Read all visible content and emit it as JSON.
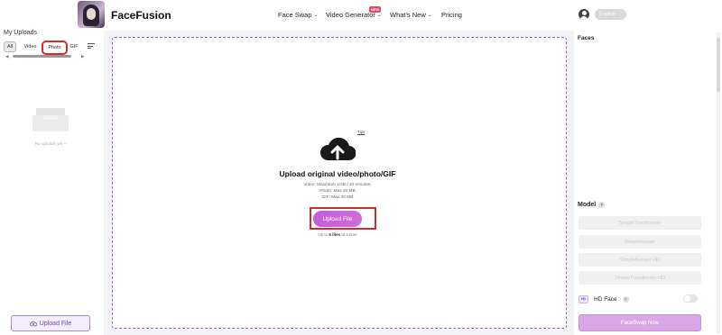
{
  "header": {
    "brand": "FaceFusion",
    "nav": [
      {
        "label": "Face Swap",
        "has_menu": true
      },
      {
        "label": "Video Generator",
        "has_menu": true,
        "badge": "NEW"
      },
      {
        "label": "What's New",
        "has_menu": true
      },
      {
        "label": "Pricing",
        "has_menu": false
      }
    ],
    "language": "English",
    "icons": {
      "user": "user-circle-icon",
      "chevron": "chevron-down-icon"
    }
  },
  "sidebar": {
    "title": "My Uploads",
    "filters": [
      {
        "label": "All",
        "active": true
      },
      {
        "label": "Video",
        "active": false
      },
      {
        "label": "Photo",
        "active": false
      },
      {
        "label": "GIF",
        "active": false
      }
    ],
    "empty_text": "No uploads yet ~",
    "upload_button": "Upload File"
  },
  "main": {
    "tips": "Tips",
    "title": "Upload original video/photo/GIF",
    "lines": [
      "Video: Maximum 1GB / 10 minutes.",
      "Photo: Max 20 MB",
      "GIF: Max 20 MB"
    ],
    "button": "Upload File",
    "limit_prefix": "Up to ",
    "limit_count": "5 files",
    "limit_suffix": " at a time"
  },
  "right": {
    "faces_title": "Faces",
    "model_title": "Model",
    "models": [
      "SimpleTransformer",
      "SimpleKeeper",
      "SimpleKeeper HD",
      "SimpleTransformer HD"
    ],
    "hd_icon_text": "HD",
    "hd_label": "HD Face",
    "hd_enabled": false,
    "swap_button": "FaceSwap Now"
  },
  "colors": {
    "accent": "#6f42c1",
    "upload_gradient_start": "#c05ed8",
    "highlight_box": "#d42a2a",
    "dropzone_border": "#9a5bd6"
  }
}
